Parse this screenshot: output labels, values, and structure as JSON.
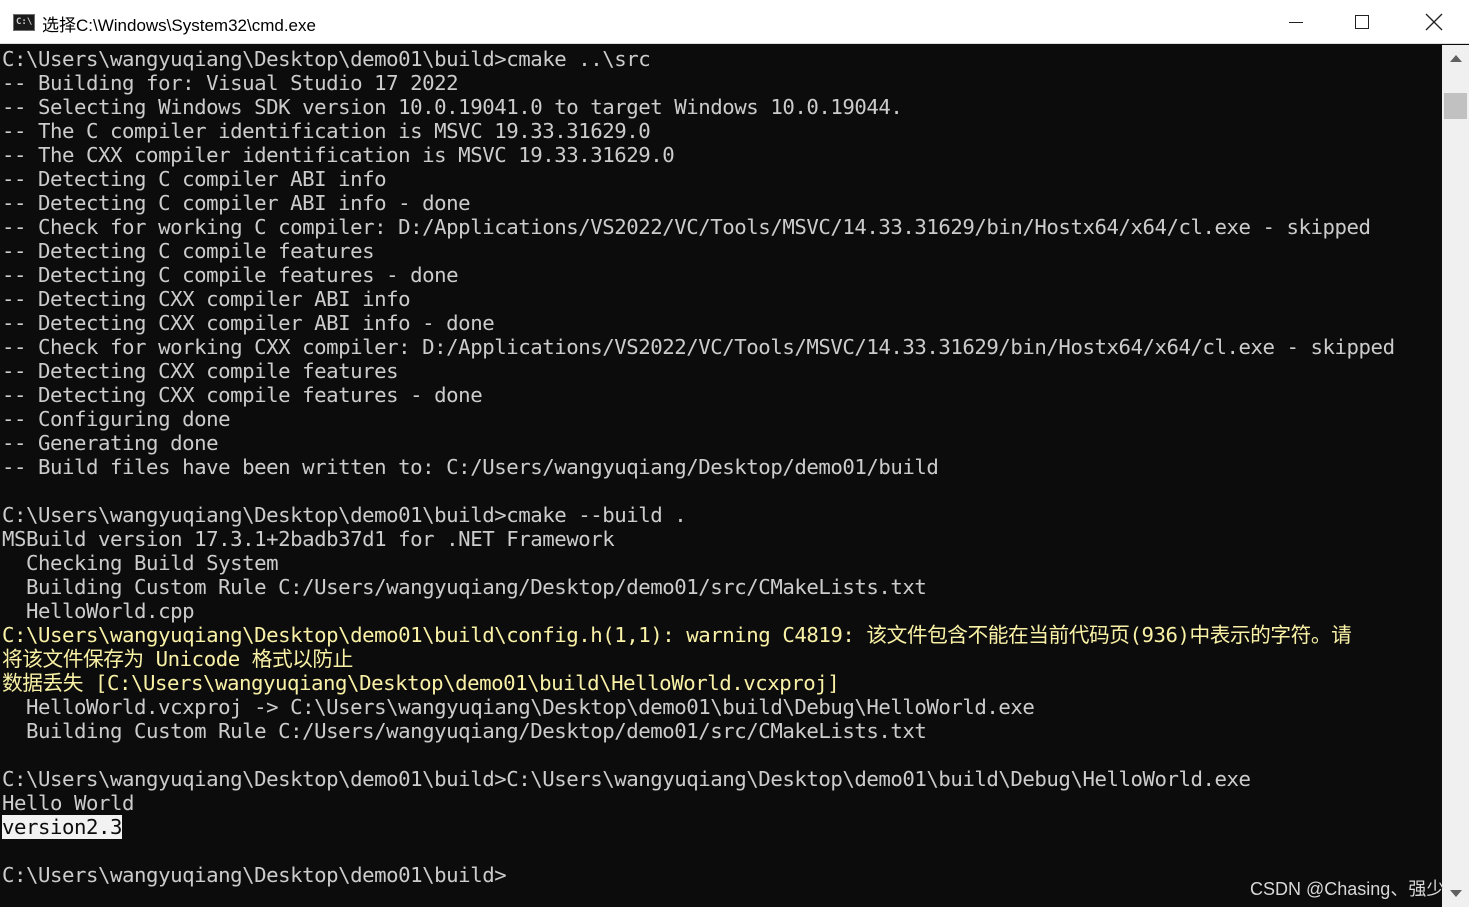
{
  "window": {
    "title": "选择C:\\Windows\\System32\\cmd.exe",
    "icon": "cmd-icon",
    "icon_glyph": "C:\\"
  },
  "controls": {
    "minimize_icon": "minimize-icon",
    "maximize_icon": "maximize-icon",
    "close_icon": "close-icon"
  },
  "console": {
    "colors": {
      "background": "#0c0c0c",
      "text": "#cccccc",
      "warning": "#f9f1a5",
      "selection_bg": "#f2f2f2"
    },
    "lines": [
      "C:\\Users\\wangyuqiang\\Desktop\\demo01\\build>cmake ..\\src",
      "-- Building for: Visual Studio 17 2022",
      "-- Selecting Windows SDK version 10.0.19041.0 to target Windows 10.0.19044.",
      "-- The C compiler identification is MSVC 19.33.31629.0",
      "-- The CXX compiler identification is MSVC 19.33.31629.0",
      "-- Detecting C compiler ABI info",
      "-- Detecting C compiler ABI info - done",
      "-- Check for working C compiler: D:/Applications/VS2022/VC/Tools/MSVC/14.33.31629/bin/Hostx64/x64/cl.exe - skipped",
      "-- Detecting C compile features",
      "-- Detecting C compile features - done",
      "-- Detecting CXX compiler ABI info",
      "-- Detecting CXX compiler ABI info - done",
      "-- Check for working CXX compiler: D:/Applications/VS2022/VC/Tools/MSVC/14.33.31629/bin/Hostx64/x64/cl.exe - skipped",
      "-- Detecting CXX compile features",
      "-- Detecting CXX compile features - done",
      "-- Configuring done",
      "-- Generating done",
      "-- Build files have been written to: C:/Users/wangyuqiang/Desktop/demo01/build",
      "",
      "C:\\Users\\wangyuqiang\\Desktop\\demo01\\build>cmake --build .",
      "MSBuild version 17.3.1+2badb37d1 for .NET Framework",
      "  Checking Build System",
      "  Building Custom Rule C:/Users/wangyuqiang/Desktop/demo01/src/CMakeLists.txt",
      "  HelloWorld.cpp",
      "C:\\Users\\wangyuqiang\\Desktop\\demo01\\build\\config.h(1,1): warning C4819: 该文件包含不能在当前代码页(936)中表示的字符。请",
      "将该文件保存为 Unicode 格式以防止",
      "数据丢失 [C:\\Users\\wangyuqiang\\Desktop\\demo01\\build\\HelloWorld.vcxproj]",
      "  HelloWorld.vcxproj -> C:\\Users\\wangyuqiang\\Desktop\\demo01\\build\\Debug\\HelloWorld.exe",
      "  Building Custom Rule C:/Users/wangyuqiang/Desktop/demo01/src/CMakeLists.txt",
      "",
      "C:\\Users\\wangyuqiang\\Desktop\\demo01\\build>C:\\Users\\wangyuqiang\\Desktop\\demo01\\build\\Debug\\HelloWorld.exe",
      "Hello World",
      "version2.3",
      "",
      "C:\\Users\\wangyuqiang\\Desktop\\demo01\\build>"
    ]
  },
  "scrollbar": {
    "up_icon": "scroll-up-arrow-icon",
    "down_icon": "scroll-down-arrow-icon"
  },
  "watermark": "CSDN @Chasing、强少"
}
